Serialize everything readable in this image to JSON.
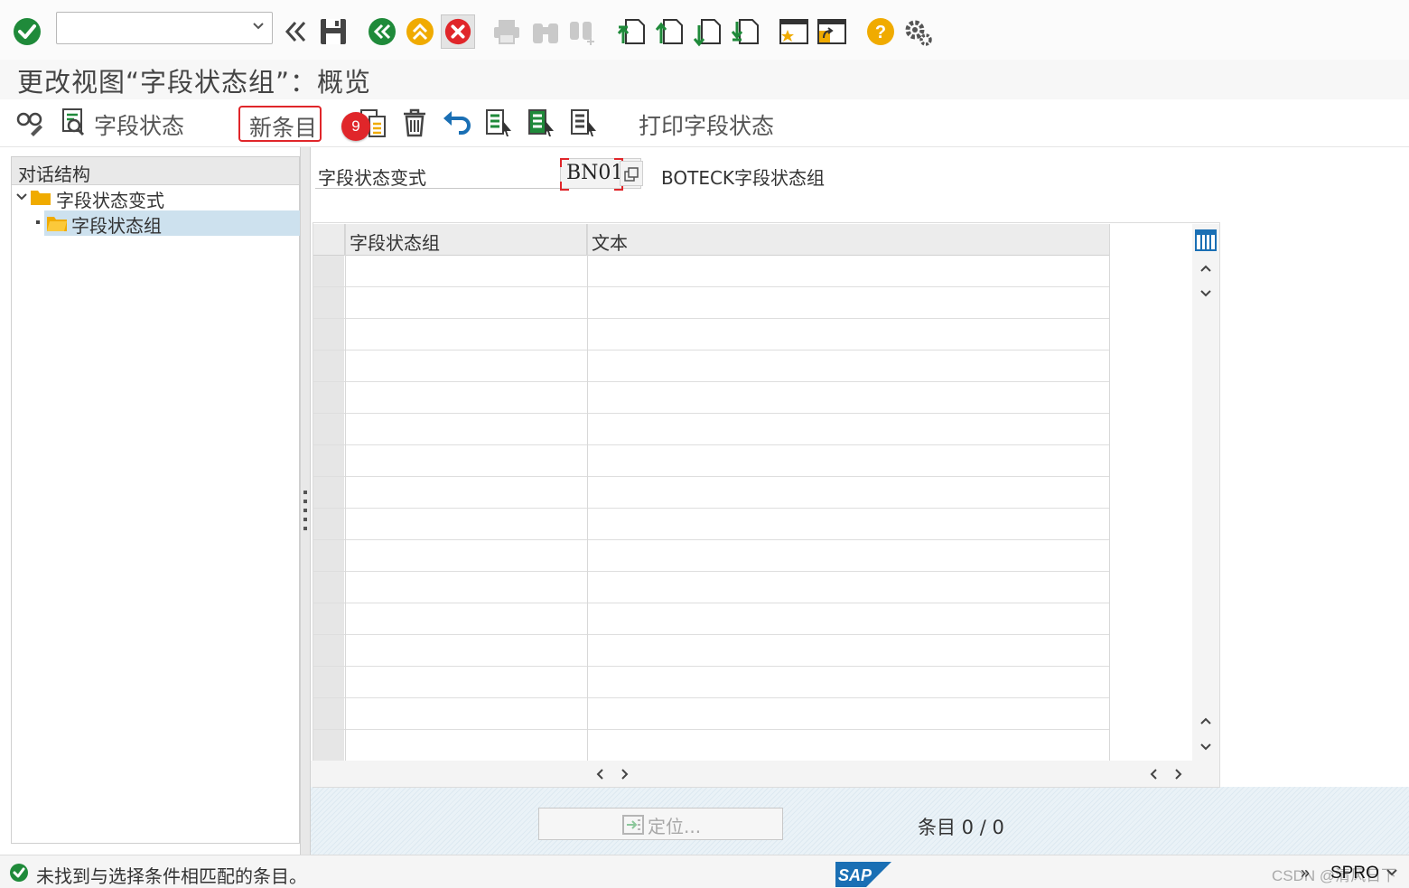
{
  "screen": {
    "title": "更改视图“字段状态组”：概览"
  },
  "app_toolbar": {
    "field_status_label": "字段状态",
    "new_entries_label": "新条目",
    "print_label": "打印字段状态",
    "step_badge": "9"
  },
  "tree": {
    "header": "对话结构",
    "nodes": [
      {
        "label": "字段状态变式"
      },
      {
        "label": "字段状态组"
      }
    ]
  },
  "form": {
    "variant_label": "字段状态变式",
    "variant_value": "BN01",
    "variant_desc": "BOTECK字段状态组"
  },
  "table": {
    "columns": [
      "字段状态组",
      "文本"
    ],
    "rows": [
      [],
      [],
      [],
      [],
      [],
      [],
      [],
      [],
      [],
      [],
      [],
      [],
      [],
      [],
      [],
      []
    ]
  },
  "footer": {
    "locate_label": "定位...",
    "entries_text": "条目 0 / 0"
  },
  "status": {
    "message": "未找到与选择条件相匹配的条目。",
    "watermark": "CSDN @清风日下",
    "transaction": "SPRO"
  },
  "colors": {
    "accent_red": "#e0262a",
    "sap_green": "#1f8a3a",
    "sap_orange": "#f0ab00",
    "sap_blue": "#1a6fb4",
    "selection": "#cde1ee"
  }
}
